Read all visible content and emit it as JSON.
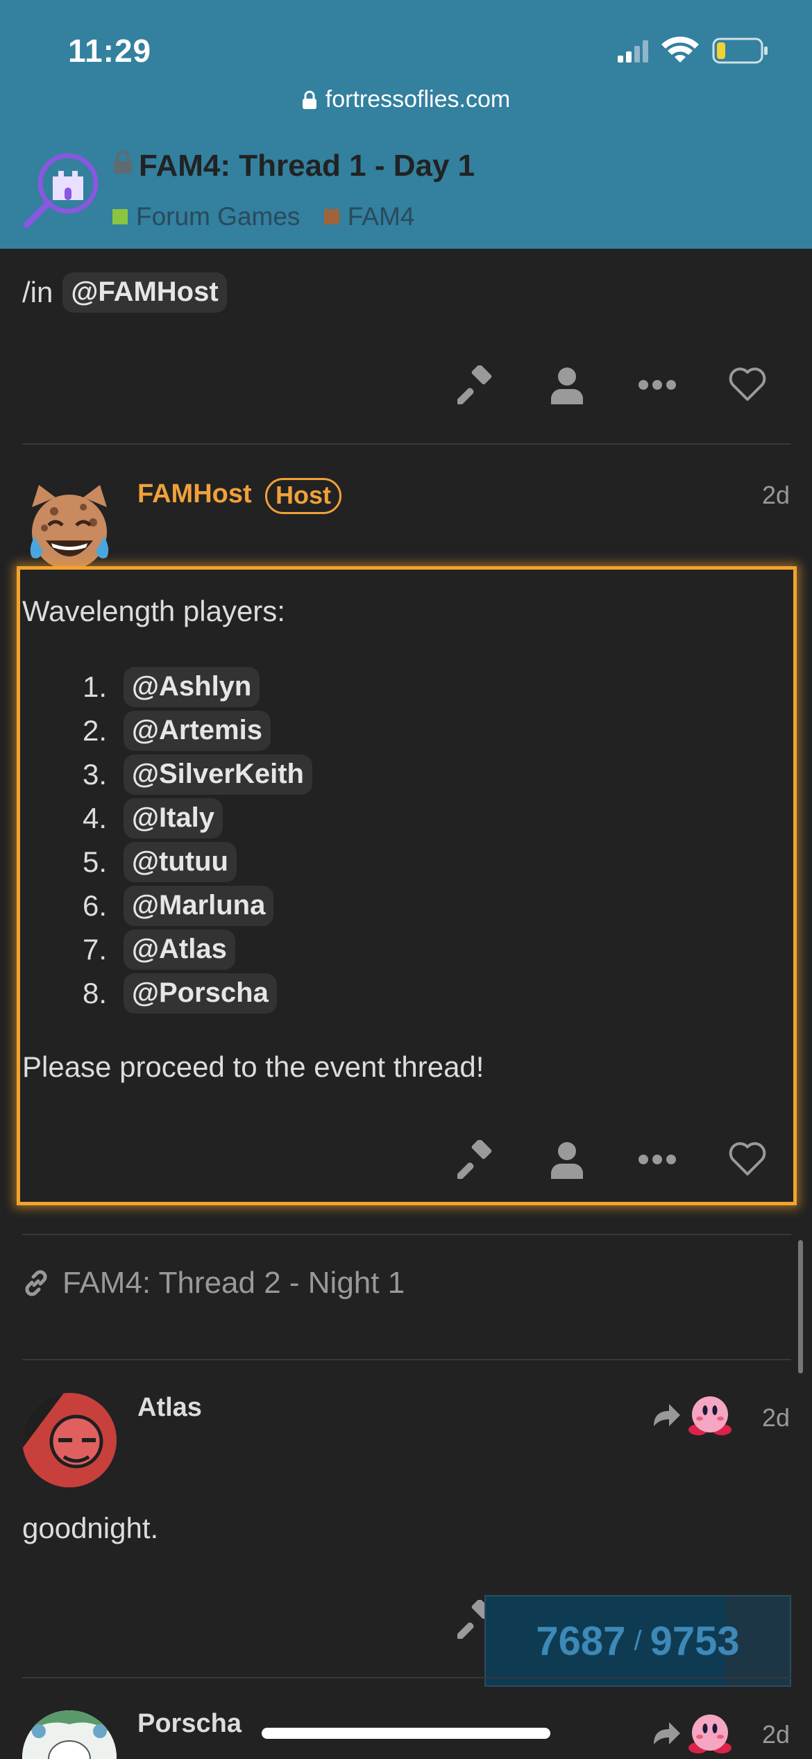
{
  "status_bar": {
    "time": "11:29",
    "battery_level": 0.2
  },
  "browser": {
    "url": "fortressoflies.com"
  },
  "topic": {
    "title": "FAM4: Thread 1 - Day 1",
    "categories": [
      {
        "label": "Forum Games",
        "color": "#8bc53f"
      },
      {
        "label": "FAM4",
        "color": "#a0643a"
      }
    ]
  },
  "prev_post": {
    "text": "/in",
    "mention": "@FAMHost"
  },
  "host_post": {
    "username": "FAMHost",
    "badge": "Host",
    "age": "2d",
    "intro": "Wavelength players:",
    "players": [
      {
        "num": "1.",
        "name": "@Ashlyn"
      },
      {
        "num": "2.",
        "name": "@Artemis"
      },
      {
        "num": "3.",
        "name": "@SilverKeith"
      },
      {
        "num": "4.",
        "name": "@Italy"
      },
      {
        "num": "5.",
        "name": "@tutuu"
      },
      {
        "num": "6.",
        "name": "@Marluna"
      },
      {
        "num": "7.",
        "name": "@Atlas"
      },
      {
        "num": "8.",
        "name": "@Porscha"
      }
    ],
    "closing": "Please proceed to the event thread!"
  },
  "linked_topic": {
    "title": "FAM4: Thread 2 - Night 1"
  },
  "atlas_post": {
    "username": "Atlas",
    "age": "2d",
    "text": "goodnight."
  },
  "porscha_post": {
    "username": "Porscha",
    "age": "2d"
  },
  "progress": {
    "current": "7687",
    "separator": "/",
    "total": "9753",
    "fraction": 0.788
  },
  "colors": {
    "header_bg": "#33809f",
    "body_bg": "#222222",
    "highlight": "#f3a32d",
    "accent": "#3d89b8"
  }
}
